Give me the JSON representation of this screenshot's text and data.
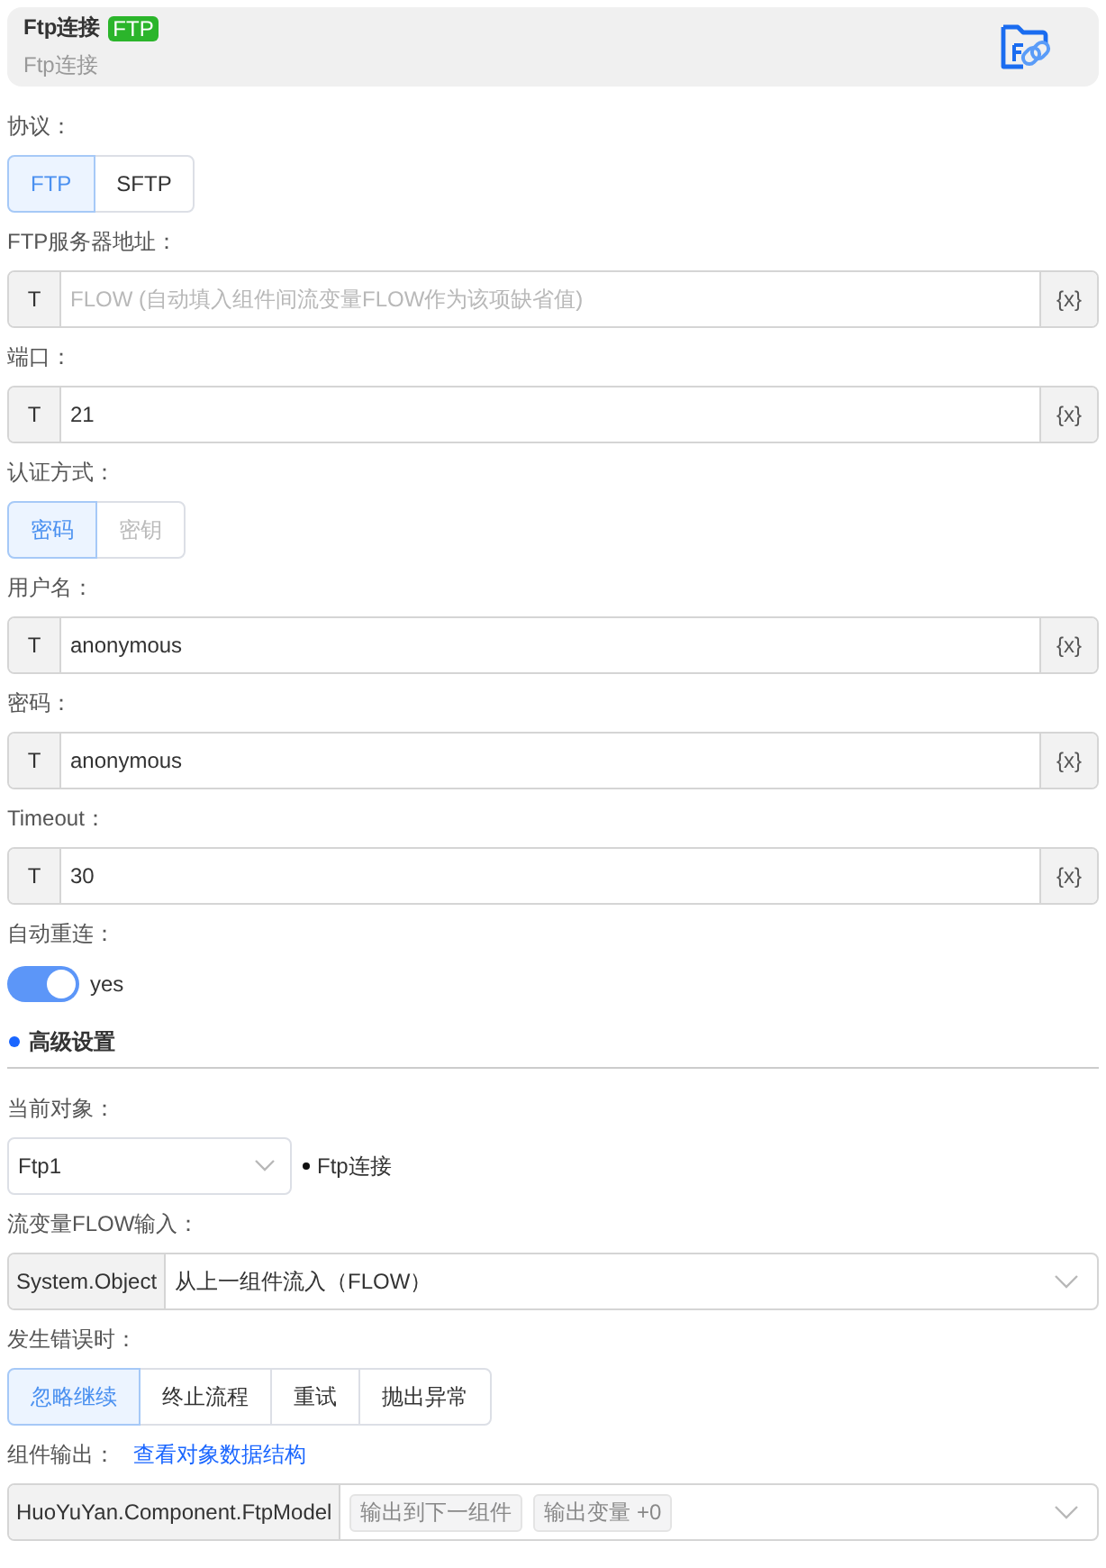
{
  "header": {
    "title": "Ftp连接",
    "badge": "FTP",
    "subtitle": "Ftp连接"
  },
  "fields": [
    {
      "kind": "segmented",
      "label": "协议：",
      "options": [
        {
          "label": "FTP",
          "selected": true,
          "disabled": false
        },
        {
          "label": "SFTP",
          "selected": false,
          "disabled": false
        }
      ]
    },
    {
      "kind": "text",
      "label": "FTP服务器地址：",
      "prefix": "T",
      "placeholder": "FLOW (自动填入组件间流变量FLOW作为该项缺省值)",
      "suffix": "{x}"
    },
    {
      "kind": "text",
      "label": "端口：",
      "prefix": "T",
      "value": "21",
      "suffix": "{x}"
    },
    {
      "kind": "segmented",
      "label": "认证方式：",
      "options": [
        {
          "label": "密码",
          "selected": true,
          "disabled": false
        },
        {
          "label": "密钥",
          "selected": false,
          "disabled": true
        }
      ]
    },
    {
      "kind": "text",
      "label": "用户名：",
      "prefix": "T",
      "value": "anonymous",
      "suffix": "{x}"
    },
    {
      "kind": "text",
      "label": "密码：",
      "prefix": "T",
      "value": "anonymous",
      "suffix": "{x}"
    },
    {
      "kind": "text",
      "label": "Timeout：",
      "prefix": "T",
      "value": "30",
      "suffix": "{x}"
    },
    {
      "kind": "toggle",
      "label": "自动重连：",
      "on": true,
      "text": "yes"
    },
    {
      "kind": "section",
      "title": "高级设置"
    },
    {
      "kind": "object-select",
      "label": "当前对象：",
      "value": "Ftp1",
      "note": "Ftp连接"
    },
    {
      "kind": "typed-select",
      "label": "流变量FLOW输入：",
      "type": "System.Object",
      "value": "从上一组件流入（FLOW）"
    },
    {
      "kind": "segmented",
      "label": "发生错误时：",
      "options": [
        {
          "label": "忽略继续",
          "selected": true,
          "disabled": false
        },
        {
          "label": "终止流程",
          "selected": false,
          "disabled": false
        },
        {
          "label": "重试",
          "selected": false,
          "disabled": false
        },
        {
          "label": "抛出异常",
          "selected": false,
          "disabled": false
        }
      ]
    },
    {
      "kind": "output-select",
      "label": "组件输出：",
      "link": "查看对象数据结构",
      "type": "HuoYuYan.Component.FtpModel",
      "tags": [
        "输出到下一组件",
        "输出变量 +0"
      ]
    }
  ]
}
